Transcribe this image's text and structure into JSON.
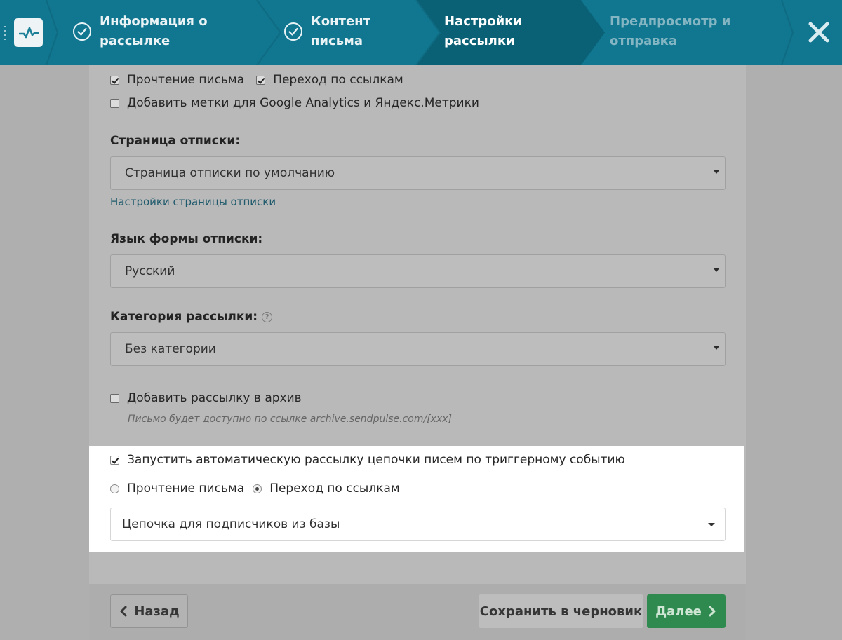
{
  "colors": {
    "topbar": "#11768f",
    "active_step": "#0a6075",
    "accent_link": "#1f5a6c",
    "next_button": "#2e8a4e"
  },
  "header": {
    "steps": [
      {
        "label": "Информация о рассылке",
        "state": "done",
        "icon": "check-circle-icon"
      },
      {
        "label": "Контент письма",
        "state": "done",
        "icon": "check-circle-icon"
      },
      {
        "label": "Настройки рассылки",
        "state": "active"
      },
      {
        "label": "Предпросмотр и отправка",
        "state": "future"
      }
    ],
    "logo_icon": "pulse-logo-icon",
    "close_icon": "close-icon"
  },
  "tracking": {
    "open_label": "Прочтение письма",
    "open_checked": true,
    "click_label": "Переход по ссылкам",
    "click_checked": true,
    "utm_label": "Добавить метки для Google Analytics и Яндекс.Метрики",
    "utm_checked": false
  },
  "unsubscribe_page": {
    "label": "Страница отписки:",
    "value": "Страница отписки по умолчанию",
    "settings_link": "Настройки страницы отписки"
  },
  "unsubscribe_language": {
    "label": "Язык формы отписки:",
    "value": "Русский"
  },
  "category": {
    "label": "Категория рассылки:",
    "value": "Без категории",
    "help_icon": "question-circle-icon"
  },
  "archive": {
    "label": "Добавить рассылку в архив",
    "checked": false,
    "hint": "Письмо будет доступно по ссылке archive.sendpulse.com/[xxx]"
  },
  "autoresponder": {
    "label": "Запустить автоматическую рассылку цепочки писем по триггерному событию",
    "checked": true,
    "trigger_open_label": "Прочтение письма",
    "trigger_click_label": "Переход по ссылкам",
    "selected_trigger": "Переход по ссылкам",
    "chain_value": "Цепочка для подписчиков из базы"
  },
  "footer": {
    "back_label": "Назад",
    "draft_label": "Сохранить в черновик",
    "next_label": "Далее"
  }
}
